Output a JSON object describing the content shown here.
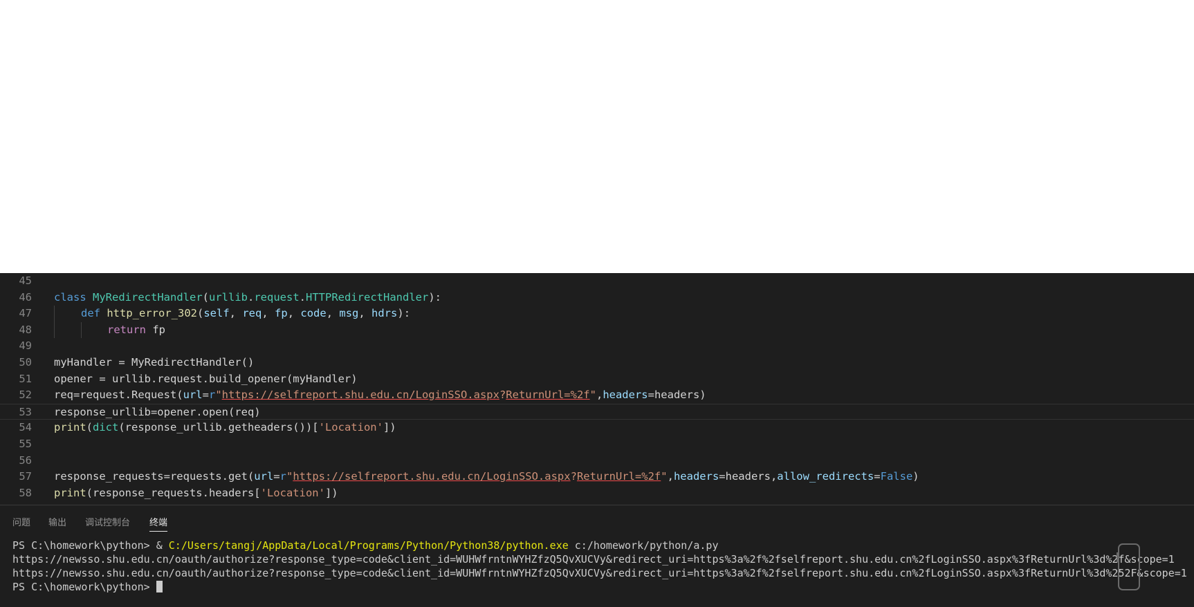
{
  "editor": {
    "lines": [
      {
        "n": "45"
      },
      {
        "n": "46",
        "t": [
          "class",
          " ",
          "MyRedirectHandler",
          "(",
          "urllib",
          ".",
          "request",
          ".",
          "HTTPRedirectHandler",
          "):"
        ]
      },
      {
        "n": "47",
        "t": [
          "def",
          " ",
          "http_error_302",
          "(",
          "self",
          ", ",
          "req",
          ", ",
          "fp",
          ", ",
          "code",
          ", ",
          "msg",
          ", ",
          "hdrs",
          "):"
        ]
      },
      {
        "n": "48",
        "t": [
          "return",
          " fp"
        ]
      },
      {
        "n": "49"
      },
      {
        "n": "50",
        "t": [
          "myHandler = ",
          "MyRedirectHandler",
          "()"
        ]
      },
      {
        "n": "51",
        "t": [
          "opener = urllib.request.build_opener(myHandler)"
        ]
      },
      {
        "n": "52",
        "t": [
          "req=request.Request(",
          "url",
          "=",
          "r",
          "\"",
          "https://selfreport.shu.edu.cn/LoginSSO.aspx",
          "?",
          "ReturnUrl=%2f",
          "\"",
          ",",
          "headers",
          "=headers)"
        ]
      },
      {
        "n": "53",
        "t": [
          "response_urllib=opener.open(req)"
        ]
      },
      {
        "n": "54",
        "t": [
          "print",
          "(",
          "dict",
          "(response_urllib.getheaders())[",
          "'Location'",
          "])"
        ]
      },
      {
        "n": "55"
      },
      {
        "n": "56"
      },
      {
        "n": "57",
        "t": [
          "response_requests=requests.get(",
          "url",
          "=",
          "r",
          "\"",
          "https://selfreport.shu.edu.cn/LoginSSO.aspx",
          "?",
          "ReturnUrl=%2f",
          "\"",
          ",",
          "headers",
          "=headers,",
          "allow_redirects",
          "=",
          "False",
          ")"
        ]
      },
      {
        "n": "58",
        "t": [
          "print",
          "(response_requests.headers[",
          "'Location'",
          "])"
        ]
      }
    ]
  },
  "panel": {
    "tabs": [
      "问题",
      "输出",
      "调试控制台",
      "终端"
    ],
    "active_tab": "终端"
  },
  "terminal": {
    "line1_prompt": "PS C:\\homework\\python> ",
    "line1_amp": "& ",
    "line1_exe": "C:/Users/tangj/AppData/Local/Programs/Python/Python38/python.exe",
    "line1_arg": " c:/homework/python/a.py",
    "line2": "https://newsso.shu.edu.cn/oauth/authorize?response_type=code&client_id=WUHWfrntnWYHZfzQ5QvXUCVy&redirect_uri=https%3a%2f%2fselfreport.shu.edu.cn%2fLoginSSO.aspx%3fReturnUrl%3d%2f&scope=1",
    "line3": "https://newsso.shu.edu.cn/oauth/authorize?response_type=code&client_id=WUHWfrntnWYHZfzQ5QvXUCVy&redirect_uri=https%3a%2f%2fselfreport.shu.edu.cn%2fLoginSSO.aspx%3fReturnUrl%3d%252F&scope=1",
    "line4_prompt": "PS C:\\homework\\python> "
  },
  "colors": {
    "editor_bg": "#1e1e1e",
    "keyword": "#569cd6",
    "control": "#c586c0",
    "class": "#4ec9b0",
    "function": "#dcdcaa",
    "param": "#9cdcfe",
    "string": "#ce9178",
    "terminal_path": "#e5e510"
  },
  "icons": [
    "phone-outline-icon"
  ]
}
